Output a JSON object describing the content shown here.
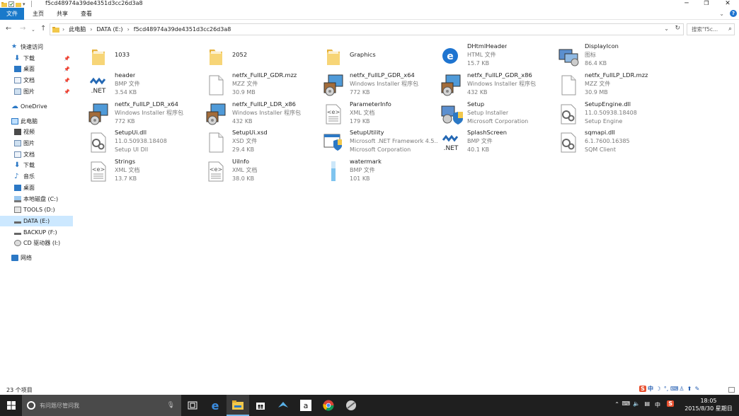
{
  "window": {
    "title": "f5cd48974a39de4351d3cc26d3a8"
  },
  "ribbon": {
    "tabs": [
      "文件",
      "主页",
      "共享",
      "查看"
    ]
  },
  "address": {
    "segments": [
      "此电脑",
      "DATA (E:)",
      "f5cd48974a39de4351d3cc26d3a8"
    ],
    "search_placeholder": "搜索\"f5c..."
  },
  "nav": {
    "quick_access": "快速访问",
    "quick_items": [
      "下载",
      "桌面",
      "文档",
      "图片"
    ],
    "onedrive": "OneDrive",
    "this_pc": "此电脑",
    "pc_items": [
      "视频",
      "图片",
      "文档",
      "下载",
      "音乐",
      "桌面",
      "本地磁盘 (C:)",
      "TOOLS (D:)",
      "DATA (E:)",
      "BACKUP (F:)",
      "CD 驱动器 (I:)"
    ],
    "network": "网络",
    "selected": "DATA (E:)"
  },
  "files": [
    {
      "name": "1033",
      "type": "",
      "size": "",
      "icon": "folder-icon"
    },
    {
      "name": "2052",
      "type": "",
      "size": "",
      "icon": "folder-icon"
    },
    {
      "name": "Graphics",
      "type": "",
      "size": "",
      "icon": "folder-icon"
    },
    {
      "name": "DHtmlHeader",
      "type": "HTML 文件",
      "size": "15.7 KB",
      "icon": "html-file-icon"
    },
    {
      "name": "DisplayIcon",
      "type": "图标",
      "size": "86.4 KB",
      "icon": "display-icon-file-icon"
    },
    {
      "name": "header",
      "type": "BMP 文件",
      "size": "3.54 KB",
      "icon": "dotnet-bmp-icon"
    },
    {
      "name": "netfx_FullLP_GDR.mzz",
      "type": "MZZ 文件",
      "size": "30.9 MB",
      "icon": "blank-file-icon"
    },
    {
      "name": "netfx_FullLP_GDR_x64",
      "type": "Windows Installer 程序包",
      "size": "772 KB",
      "icon": "installer-package-icon"
    },
    {
      "name": "netfx_FullLP_GDR_x86",
      "type": "Windows Installer 程序包",
      "size": "432 KB",
      "icon": "installer-package-icon"
    },
    {
      "name": "netfx_FullLP_LDR.mzz",
      "type": "MZZ 文件",
      "size": "30.9 MB",
      "icon": "blank-file-icon"
    },
    {
      "name": "netfx_FullLP_LDR_x64",
      "type": "Windows Installer 程序包",
      "size": "772 KB",
      "icon": "installer-package-icon"
    },
    {
      "name": "netfx_FullLP_LDR_x86",
      "type": "Windows Installer 程序包",
      "size": "432 KB",
      "icon": "installer-package-icon"
    },
    {
      "name": "ParameterInfo",
      "type": "XML 文档",
      "size": "179 KB",
      "icon": "xml-document-icon"
    },
    {
      "name": "Setup",
      "type": "Setup Installer",
      "size": "Microsoft Corporation",
      "icon": "setup-installer-icon"
    },
    {
      "name": "SetupEngine.dll",
      "type": "11.0.50938.18408",
      "size": "Setup Engine",
      "icon": "dll-gear-icon"
    },
    {
      "name": "SetupUi.dll",
      "type": "11.0.50938.18408",
      "size": "Setup UI Dll",
      "icon": "dll-gear-icon"
    },
    {
      "name": "SetupUi.xsd",
      "type": "XSD 文件",
      "size": "29.4 KB",
      "icon": "blank-file-icon"
    },
    {
      "name": "SetupUtility",
      "type": "Microsoft .NET Framework 4.5...",
      "size": "Microsoft Corporation",
      "icon": "setup-utility-icon"
    },
    {
      "name": "SplashScreen",
      "type": "BMP 文件",
      "size": "40.1 KB",
      "icon": "dotnet-bmp-icon"
    },
    {
      "name": "sqmapi.dll",
      "type": "6.1.7600.16385",
      "size": "SQM Client",
      "icon": "dll-gear-icon"
    },
    {
      "name": "Strings",
      "type": "XML 文档",
      "size": "13.7 KB",
      "icon": "xml-document-icon"
    },
    {
      "name": "UiInfo",
      "type": "XML 文档",
      "size": "38.0 KB",
      "icon": "xml-document-icon"
    },
    {
      "name": "watermark",
      "type": "BMP 文件",
      "size": "101 KB",
      "icon": "watermark-bmp-icon"
    }
  ],
  "status": {
    "item_count": "23 个项目"
  },
  "taskbar": {
    "search_placeholder": "有问题尽管问我",
    "apps": [
      "task-view-icon",
      "edge-icon",
      "file-explorer-icon",
      "store-icon",
      "app-bird-icon",
      "amazon-icon",
      "chrome-icon",
      "app-feather-icon"
    ],
    "active_app": "file-explorer-icon",
    "tray_text": [
      "中",
      "中"
    ],
    "time": "18:05",
    "date": "2015/8/30 星期日"
  },
  "ime_bar": {
    "label": "中"
  },
  "colors": {
    "accent": "#1979ca",
    "selection": "#cce8ff",
    "taskbar": "#1f1f1f",
    "folder": "#f2c84b"
  }
}
